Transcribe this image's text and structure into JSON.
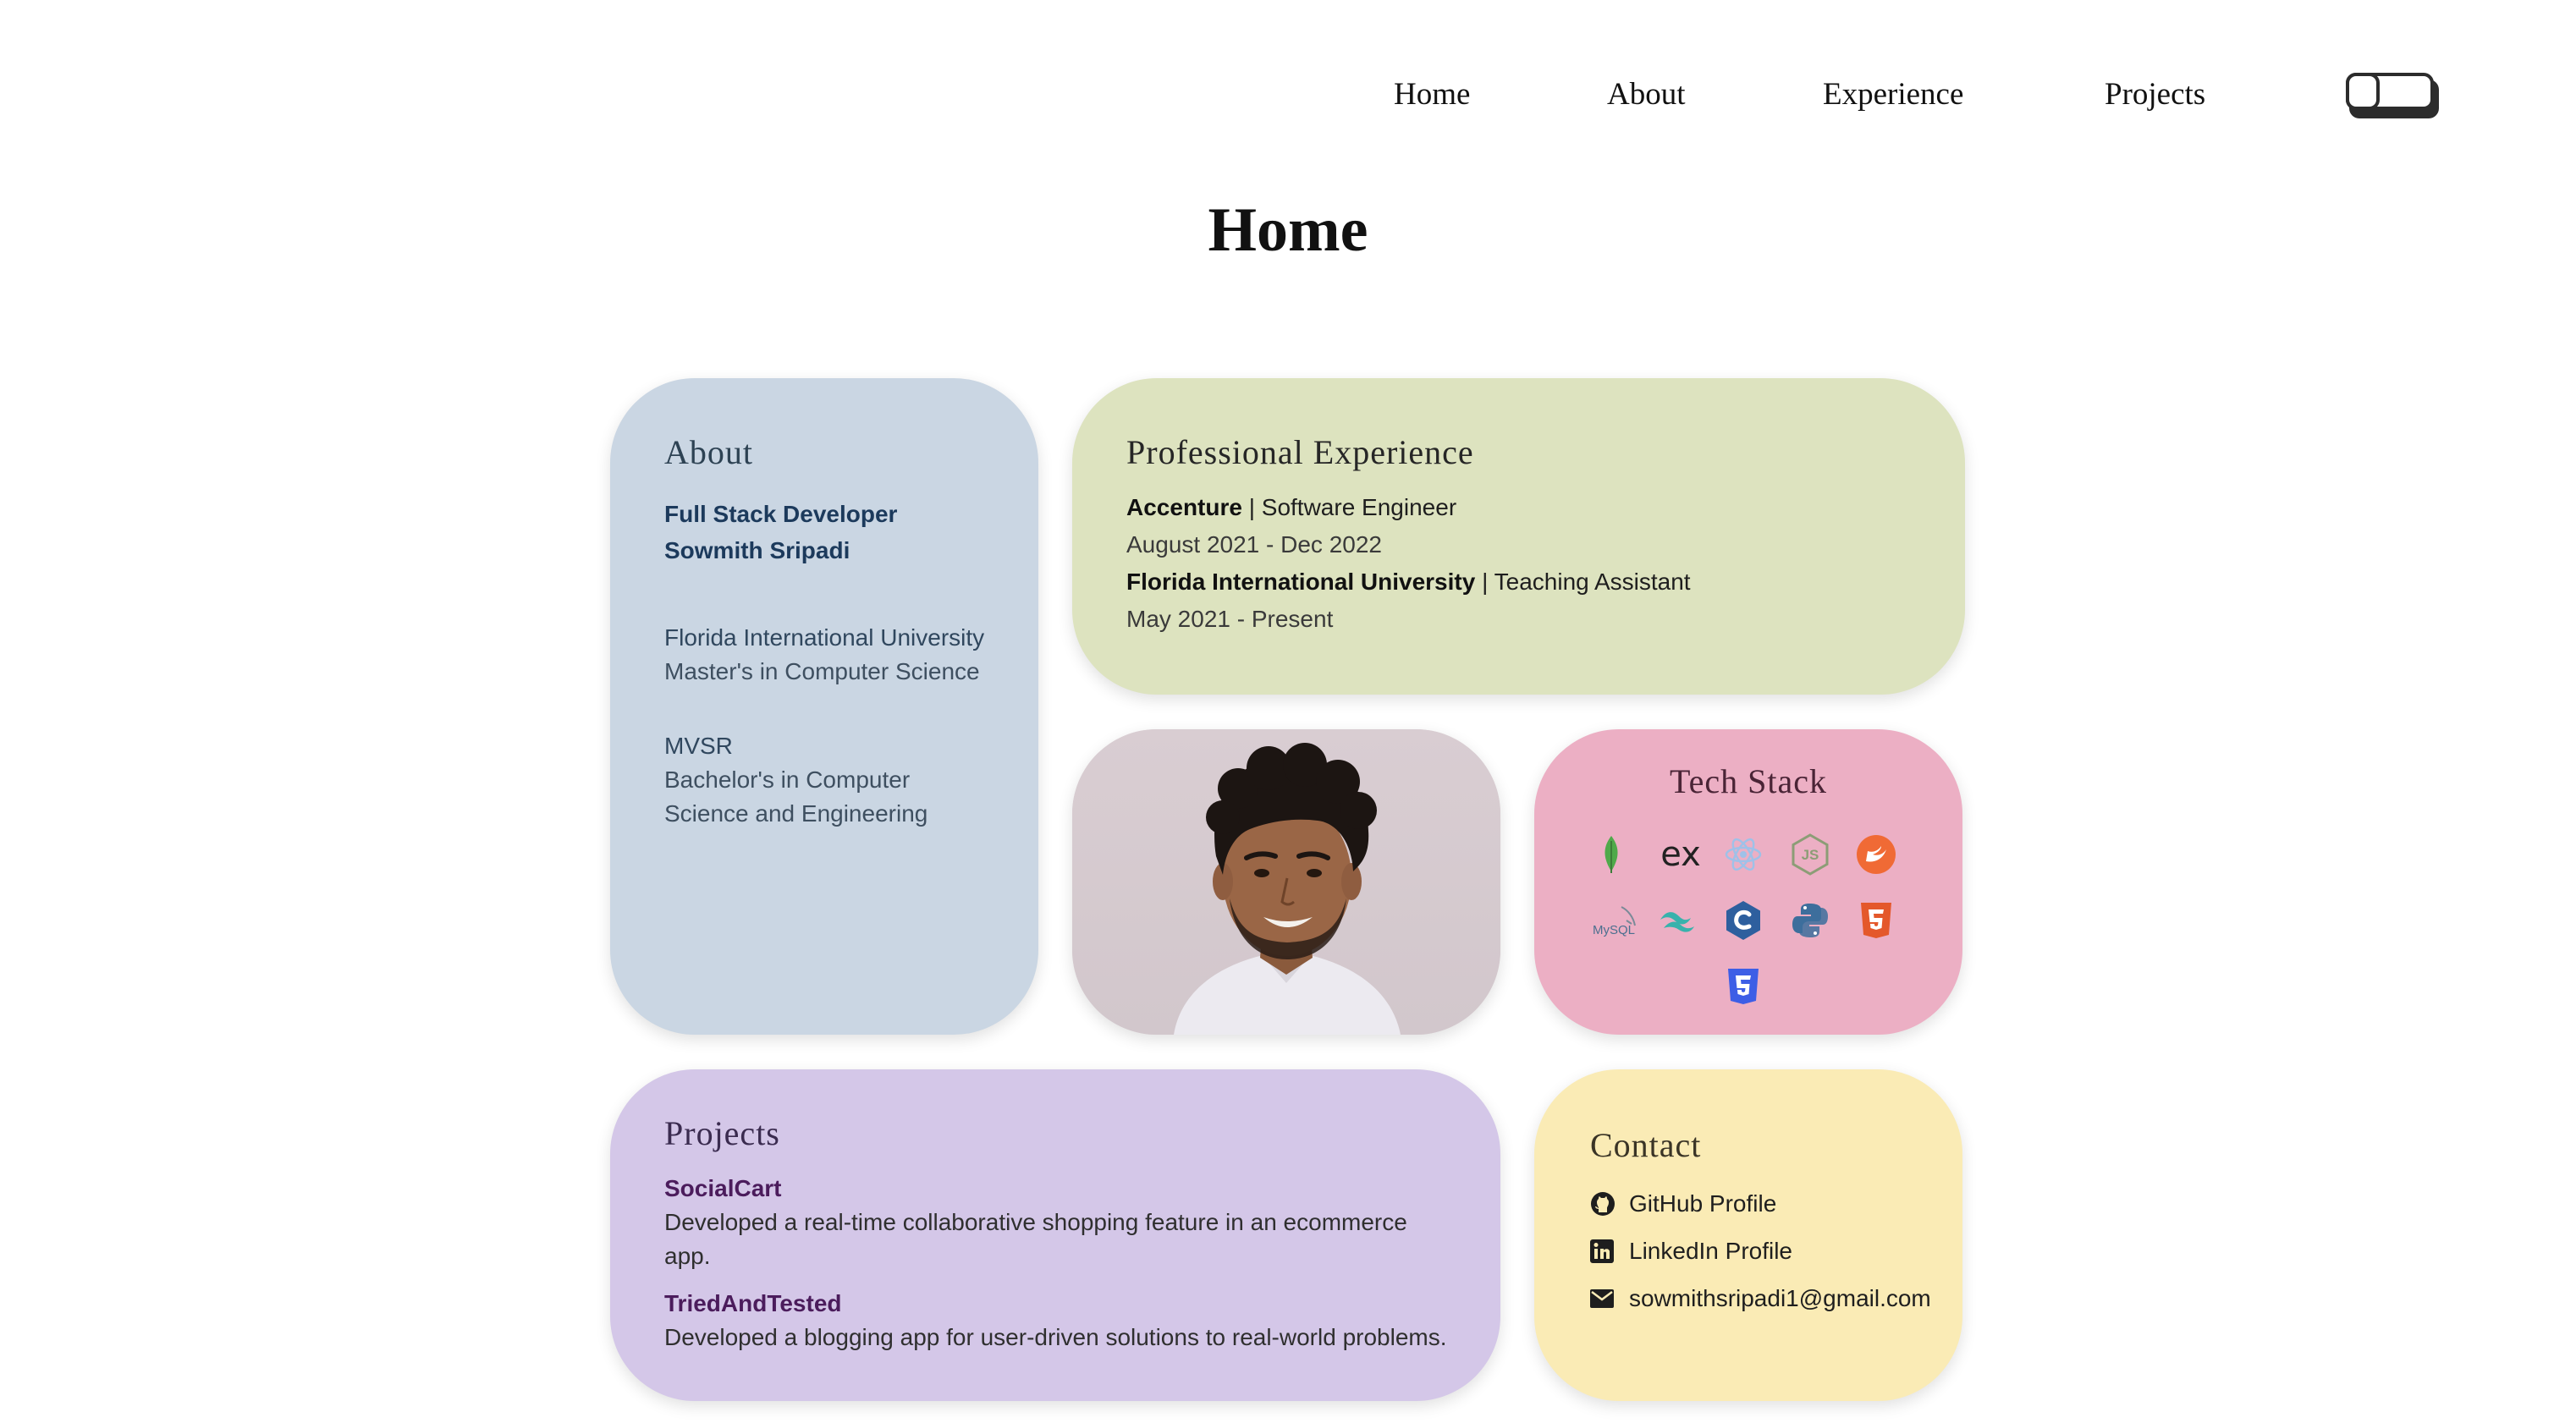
{
  "nav": {
    "items": [
      {
        "label": "Home"
      },
      {
        "label": "About"
      },
      {
        "label": "Experience"
      },
      {
        "label": "Projects"
      }
    ],
    "theme_toggle_icon": "toggle-icon"
  },
  "page_title": "Home",
  "about": {
    "title": "About",
    "role": "Full Stack Developer",
    "name": "Sowmith Sripadi",
    "education": [
      {
        "school": "Florida International University",
        "degree": "Master's in Computer Science"
      },
      {
        "school": "MVSR",
        "degree_line1": "Bachelor's in Computer",
        "degree_line2": "Science and Engineering"
      }
    ]
  },
  "experience": {
    "title": "Professional Experience",
    "items": [
      {
        "company": "Accenture",
        "separator": " | ",
        "role": "Software Engineer",
        "dates": "August 2021 - Dec 2022"
      },
      {
        "company": "Florida International University",
        "separator": " | ",
        "role": "Teaching Assistant",
        "dates": "May 2021 - Present"
      }
    ]
  },
  "photo": {
    "icon": "profile-photo"
  },
  "tech_stack": {
    "title": "Tech Stack",
    "icons": [
      "mongodb-icon",
      "express-icon",
      "react-icon",
      "nodejs-icon",
      "swift-icon",
      "mysql-icon",
      "tailwind-icon",
      "c-lang-icon",
      "python-icon",
      "html5-icon",
      "css3-icon"
    ],
    "express_text": "ex",
    "mysql_text": "MySQL",
    "colors": {
      "mongodb": "#4fa94a",
      "react": "#9fc1e8",
      "nodejs": "#8c9d76",
      "swift": "#f06a35",
      "tailwind": "#38b2ac",
      "c": "#2e5f9e",
      "python": "#3d6e9c",
      "html5": "#e4582b",
      "css3": "#3d5ee6"
    }
  },
  "projects": {
    "title": "Projects",
    "items": [
      {
        "name": "SocialCart",
        "description": "Developed a real-time collaborative shopping feature in an ecommerce app."
      },
      {
        "name": "TriedAndTested",
        "description": "Developed a blogging app for user-driven solutions to real-world problems."
      }
    ]
  },
  "contact": {
    "title": "Contact",
    "links": [
      {
        "label": "GitHub Profile",
        "icon": "github-icon"
      },
      {
        "label": "LinkedIn Profile",
        "icon": "linkedin-icon"
      },
      {
        "label": "sowmithsripadi1@gmail.com",
        "icon": "mail-icon"
      }
    ]
  },
  "colors": {
    "about_card": "#cad6e3",
    "experience_card": "#dde3bf",
    "tech_card": "#ecafc4",
    "projects_card": "#d4c7e8",
    "contact_card": "#faebb5"
  }
}
